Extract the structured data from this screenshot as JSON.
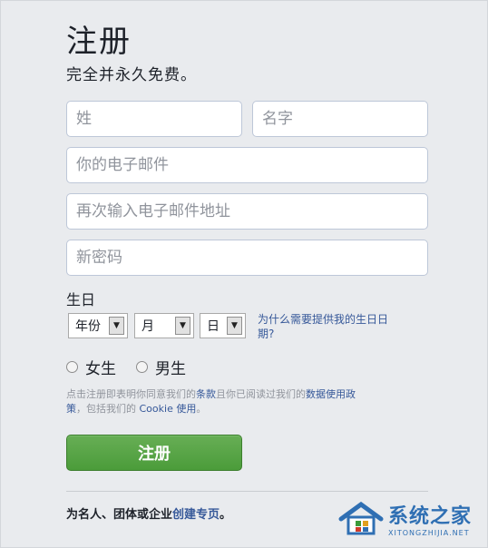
{
  "header": {
    "title": "注册",
    "subtitle": "完全并永久免费。"
  },
  "fields": {
    "last_name_placeholder": "姓",
    "first_name_placeholder": "名字",
    "email_placeholder": "你的电子邮件",
    "email_confirm_placeholder": "再次输入电子邮件地址",
    "password_placeholder": "新密码"
  },
  "birthday": {
    "label": "生日",
    "year": "年份",
    "month": "月",
    "day": "日",
    "why_link": "为什么需要提供我的生日日期?"
  },
  "gender": {
    "female": "女生",
    "male": "男生"
  },
  "terms": {
    "prefix": "点击注册即表明你同意我们的",
    "terms_link": "条款",
    "middle": "且你已阅读过我们的",
    "data_policy_link": "数据使用政策",
    "middle2": "，包括我们的 ",
    "cookie_link": "Cookie 使用",
    "suffix": "。"
  },
  "signup_button": "注册",
  "page_link": {
    "prefix": "为名人、团体或企业",
    "link": "创建专页",
    "suffix": "。"
  },
  "watermark": {
    "cn": "系统之家",
    "en": "XITONGZHIJIA.NET"
  }
}
